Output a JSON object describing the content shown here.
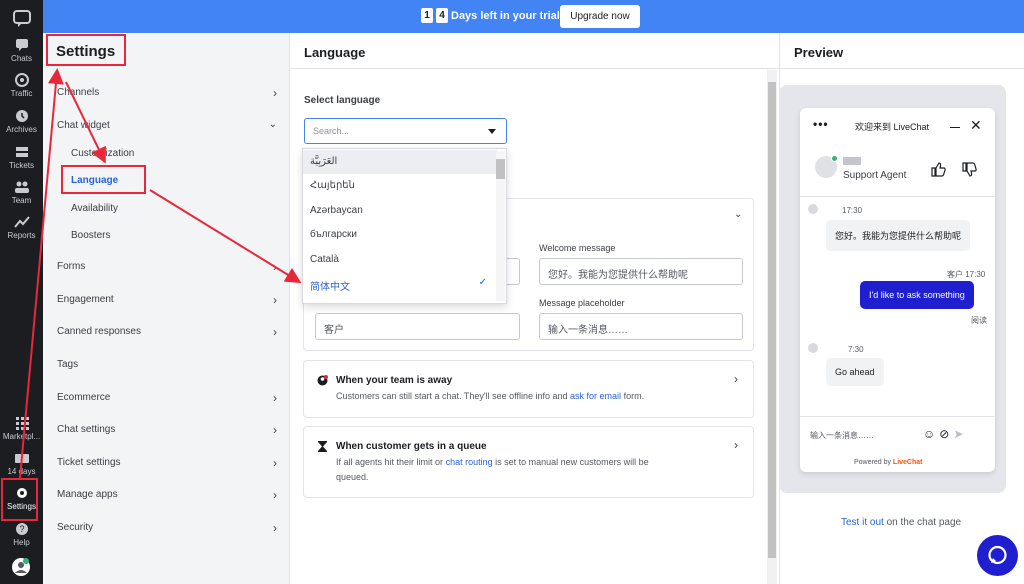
{
  "banner": {
    "digits": [
      "1",
      "4"
    ],
    "text": "Days left in your trial.",
    "upgrade_label": "Upgrade now",
    "color": "#4384f5"
  },
  "rail": {
    "items": [
      {
        "label": "Chats",
        "icon": "chat-icon"
      },
      {
        "label": "Traffic",
        "icon": "traffic-icon"
      },
      {
        "label": "Archives",
        "icon": "archive-icon"
      },
      {
        "label": "Tickets",
        "icon": "ticket-icon"
      },
      {
        "label": "Team",
        "icon": "team-icon"
      },
      {
        "label": "Reports",
        "icon": "reports-icon"
      }
    ],
    "marketplace": "Marketpl...",
    "trial_days": "14 days",
    "settings": "Settings",
    "help": "Help"
  },
  "settings_sidebar": {
    "title": "Settings",
    "channels": "Channels",
    "chat_widget": "Chat widget",
    "sub_items": [
      "Customization",
      "Language",
      "Availability",
      "Boosters"
    ],
    "forms": "Forms",
    "engagement": "Engagement",
    "canned_responses": "Canned responses",
    "tags": "Tags",
    "ecommerce": "Ecommerce",
    "chat_settings": "Chat settings",
    "ticket_settings": "Ticket settings",
    "manage_apps": "Manage apps",
    "security": "Security"
  },
  "language_panel": {
    "title": "Language",
    "select_label": "Select language",
    "search_placeholder": "Search...",
    "dropdown_options": [
      "العَرَبِيَّة",
      "Հայերեն",
      "Azərbaycan",
      "български",
      "Català",
      "简体中文"
    ],
    "selected_option": "简体中文",
    "welcome_label": "Welcome message",
    "welcome_value": "您好。我能为您提供什么帮助呢",
    "placeholder_label": "Message placeholder",
    "placeholder_value": "输入一条消息……",
    "customer_value": "客户",
    "away_title": "When your team is away",
    "away_desc_1": "Customers can still start a chat. They'll see offline info and",
    "away_link": "ask for email",
    "away_desc_2": "form.",
    "queue_title": "When customer gets in a queue",
    "queue_desc_1": "If all agents hit their limit or",
    "queue_link": "chat routing",
    "queue_desc_2": "is set to manual new customers will be",
    "queue_desc_3": "queued."
  },
  "preview": {
    "title": "Preview",
    "chat_title": "欢迎来到 LiveChat",
    "agent_role": "Support Agent",
    "msg1_time": "17:30",
    "msg1": "您好。我能为您提供什么帮助呢",
    "msg2_meta": "客户 17:30",
    "msg2": "I'd like to ask something",
    "msg2_status": "阅读",
    "msg3_time": "7:30",
    "msg3": "Go ahead",
    "input_placeholder": "输入一条消息……",
    "powered_by": "Powered by",
    "powered_brand": "LiveChat",
    "test_link": "Test it out",
    "test_rest": "on the chat page",
    "send_color": "#1f1fd0"
  }
}
